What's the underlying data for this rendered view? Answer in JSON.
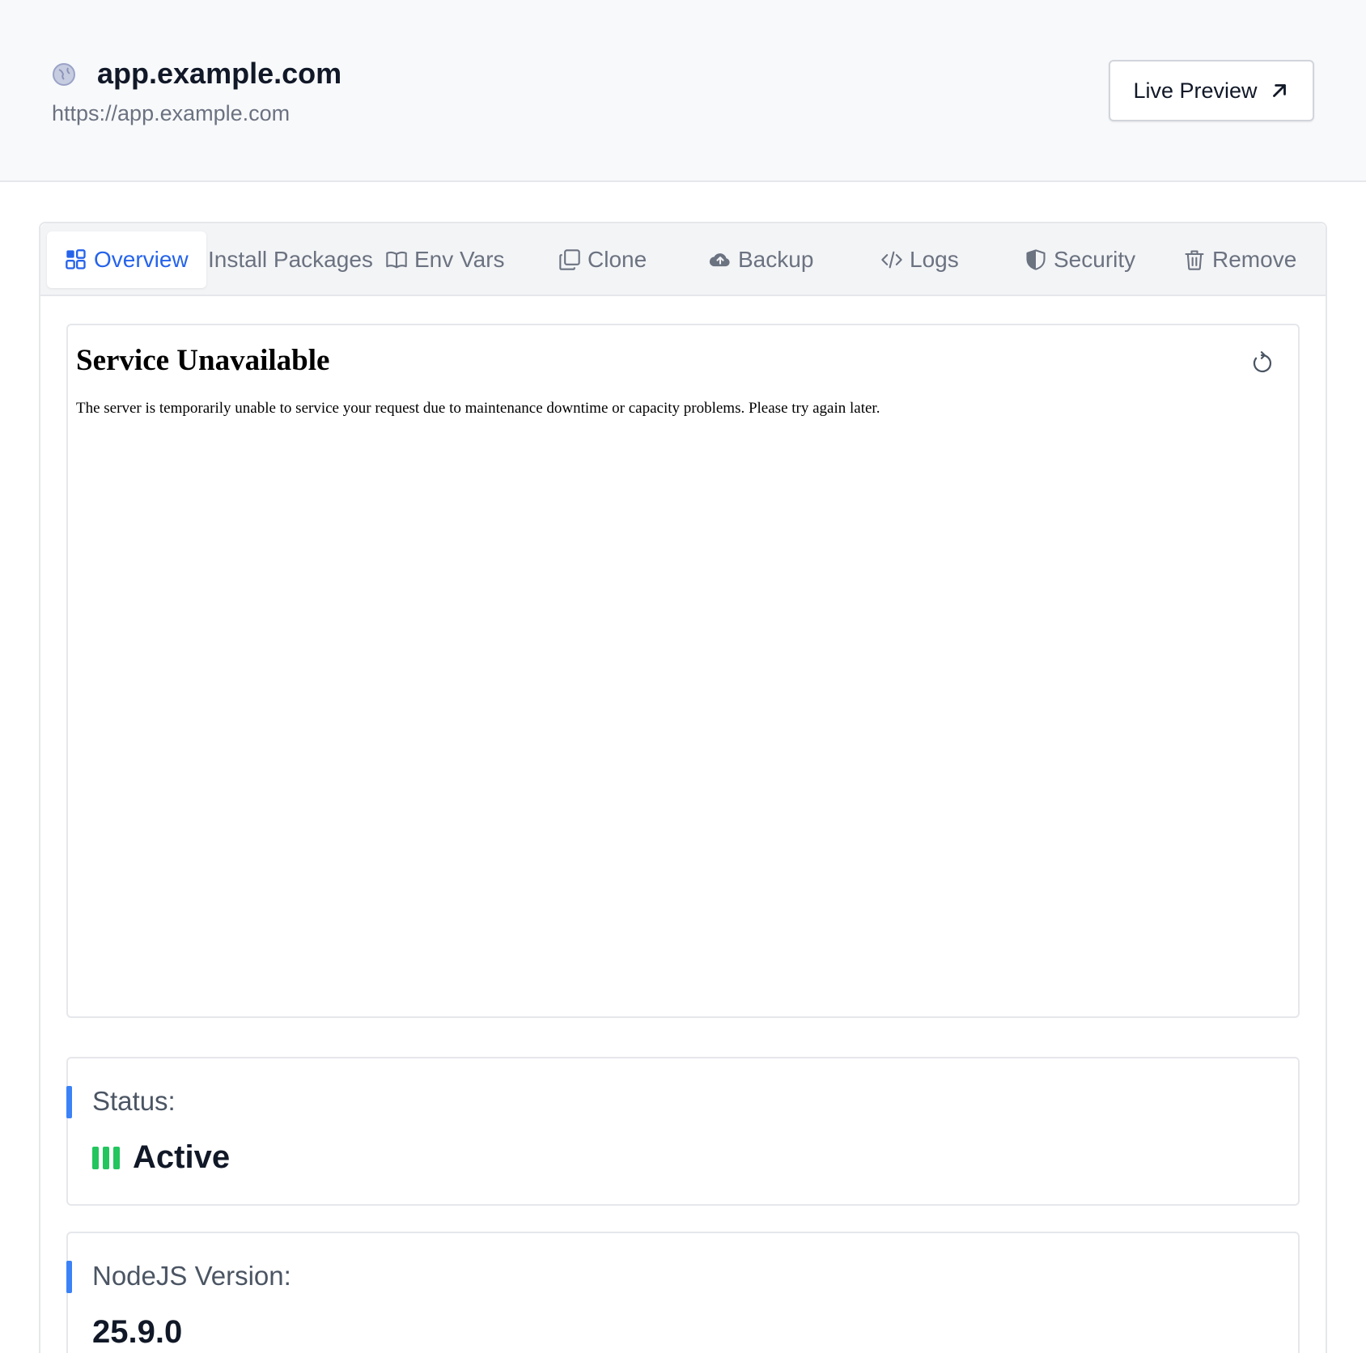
{
  "header": {
    "title": "app.example.com",
    "url": "https://app.example.com",
    "site_icon": "globe-icon",
    "live_preview_label": "Live Preview",
    "live_preview_icon": "arrow-up-right-icon"
  },
  "tabs": [
    {
      "label": "Overview",
      "icon": "grid-icon",
      "active": true
    },
    {
      "label": "Install Packages",
      "icon": "",
      "active": false
    },
    {
      "label": "Env Vars",
      "icon": "book-icon",
      "active": false
    },
    {
      "label": "Clone",
      "icon": "copy-icon",
      "active": false
    },
    {
      "label": "Backup",
      "icon": "cloud-upload-icon",
      "active": false
    },
    {
      "label": "Logs",
      "icon": "code-icon",
      "active": false
    },
    {
      "label": "Security",
      "icon": "shield-icon",
      "active": false
    },
    {
      "label": "Remove",
      "icon": "trash-icon",
      "active": false
    }
  ],
  "preview": {
    "heading": "Service Unavailable",
    "message": "The server is temporarily unable to service your request due to maintenance downtime or capacity problems. Please try again later.",
    "refresh_icon": "refresh-icon"
  },
  "status": {
    "label": "Status:",
    "value": "Active",
    "color": "#22c55e"
  },
  "node": {
    "label": "NodeJS Version:",
    "value": "25.9.0"
  },
  "colors": {
    "accent": "#2563eb",
    "card_accent": "#3b82f6",
    "header_bg": "#f8f9fb"
  }
}
